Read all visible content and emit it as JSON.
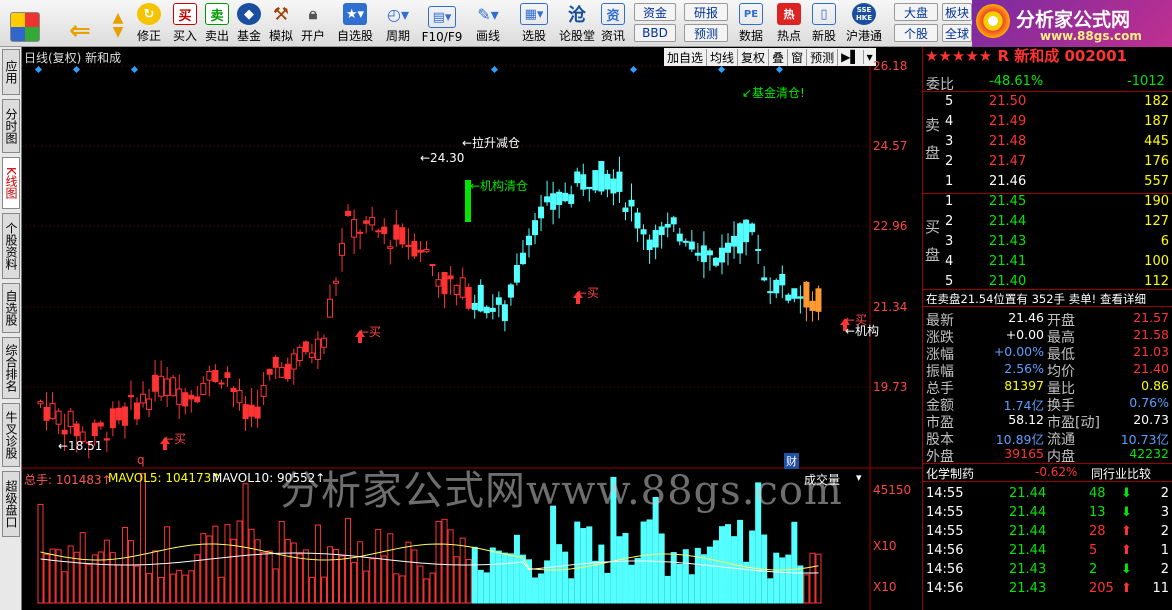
{
  "toolbar": {
    "buttons": [
      {
        "id": "back",
        "label": ""
      },
      {
        "id": "fix",
        "label": "修正"
      },
      {
        "id": "buy",
        "label": "买入"
      },
      {
        "id": "sell",
        "label": "卖出"
      },
      {
        "id": "fund",
        "label": "基金"
      },
      {
        "id": "sim",
        "label": "模拟"
      },
      {
        "id": "open",
        "label": "开户"
      },
      {
        "id": "selfsel",
        "label": "自选股"
      },
      {
        "id": "period",
        "label": "周期"
      },
      {
        "id": "f10",
        "label": "F10/F9"
      },
      {
        "id": "draw",
        "label": "画线"
      },
      {
        "id": "pick",
        "label": "选股"
      },
      {
        "id": "forum",
        "label": "论股堂"
      },
      {
        "id": "news",
        "label": "资讯"
      },
      {
        "id": "data",
        "label": "数据"
      },
      {
        "id": "hot",
        "label": "热点"
      },
      {
        "id": "newstock",
        "label": "新股"
      },
      {
        "id": "hk",
        "label": "沪港通"
      }
    ],
    "small": {
      "capital": "资金",
      "bbd": "BBD",
      "research": "研报",
      "forecast": "预测",
      "market": "大盘",
      "sector": "板块",
      "single": "个股",
      "full": "全球"
    },
    "icon_text": {
      "buy": "买",
      "sell": "卖",
      "pe": "PE",
      "news": "资",
      "hot": "热",
      "hk": "SSE HKE"
    }
  },
  "logo": {
    "title": "分析家公式网",
    "url": "www.88gs.com"
  },
  "sidebar": [
    "应用",
    "分时图",
    "K线图",
    "个股资料",
    "自选股",
    "综合排名",
    "牛叉诊股",
    "超级盘口"
  ],
  "chart": {
    "title": "日线(复权)  新和成",
    "menu": [
      "加自选",
      "均线",
      "复权",
      "叠",
      "窗",
      "预测"
    ],
    "y_ticks": [
      "26.18",
      "24.57",
      "22.96",
      "21.34",
      "19.73"
    ],
    "annotations": {
      "pullup": "←拉升减仓",
      "high": "←24.30",
      "inst": "←机构清仓",
      "fund": "↙基金清仓!",
      "low": "←18.51",
      "buy": "←买",
      "inst2": "←机构",
      "q": "q",
      "cai": "财"
    }
  },
  "chart_data": {
    "type": "candlestick",
    "y_range": [
      18.2,
      26.4
    ],
    "note": "daily K-line of 新和成 with volume",
    "ohlc_count": 130
  },
  "volume": {
    "label_total": "总手: 101483↑",
    "label_ma5": "MAVOL5: 104173↑",
    "label_ma10": "MAVOL10: 90552↑",
    "title": "成交量",
    "y_tick": "45150",
    "mid_tick": "X10",
    "bot_tick": "X10"
  },
  "right": {
    "stock": "★★★★★ R 新和成 002001",
    "weibi": {
      "label": "委比",
      "pct": "-48.61%",
      "diff": "-1012"
    },
    "sell": [
      {
        "n": "5",
        "p": "21.50",
        "v": "182"
      },
      {
        "n": "4",
        "p": "21.49",
        "v": "187"
      },
      {
        "n": "3",
        "p": "21.48",
        "v": "445"
      },
      {
        "n": "2",
        "p": "21.47",
        "v": "176"
      },
      {
        "n": "1",
        "p": "21.46",
        "v": "557"
      }
    ],
    "buy": [
      {
        "n": "1",
        "p": "21.45",
        "v": "190"
      },
      {
        "n": "2",
        "p": "21.44",
        "v": "127"
      },
      {
        "n": "3",
        "p": "21.43",
        "v": "6"
      },
      {
        "n": "4",
        "p": "21.41",
        "v": "100"
      },
      {
        "n": "5",
        "p": "21.40",
        "v": "112"
      }
    ],
    "sell_label": "卖盘",
    "buy_label": "买盘",
    "notice": "在卖盘21.54位置有  352手  卖单! 查看详细",
    "stats": [
      [
        "最新",
        "21.46",
        "开盘",
        "21.57"
      ],
      [
        "涨跌",
        "+0.00",
        "最高",
        "21.58"
      ],
      [
        "涨幅",
        "+0.00%",
        "最低",
        "21.03"
      ],
      [
        "振幅",
        "2.56%",
        "均价",
        "21.40"
      ],
      [
        "总手",
        "81397",
        "量比",
        "0.86"
      ],
      [
        "金额",
        "1.74亿",
        "换手",
        "0.76%"
      ],
      [
        "市盈",
        "58.12",
        "市盈[动]",
        "20.73"
      ],
      [
        "股本",
        "10.89亿",
        "流通",
        "10.73亿"
      ],
      [
        "外盘",
        "39165",
        "内盘",
        "42232"
      ]
    ],
    "industry": {
      "name": "化学制药",
      "pct": "-0.62%",
      "compare": "同行业比较"
    },
    "ticks": [
      [
        "14:55",
        "21.44",
        "48",
        "2"
      ],
      [
        "14:55",
        "21.44",
        "13",
        "3"
      ],
      [
        "14:55",
        "21.44",
        "28",
        "2"
      ],
      [
        "14:56",
        "21.44",
        "5",
        "1"
      ],
      [
        "14:56",
        "21.43",
        "2",
        "2"
      ],
      [
        "14:56",
        "21.43",
        "205",
        "11"
      ]
    ]
  },
  "watermark": "分析家公式网www.88gs.com"
}
